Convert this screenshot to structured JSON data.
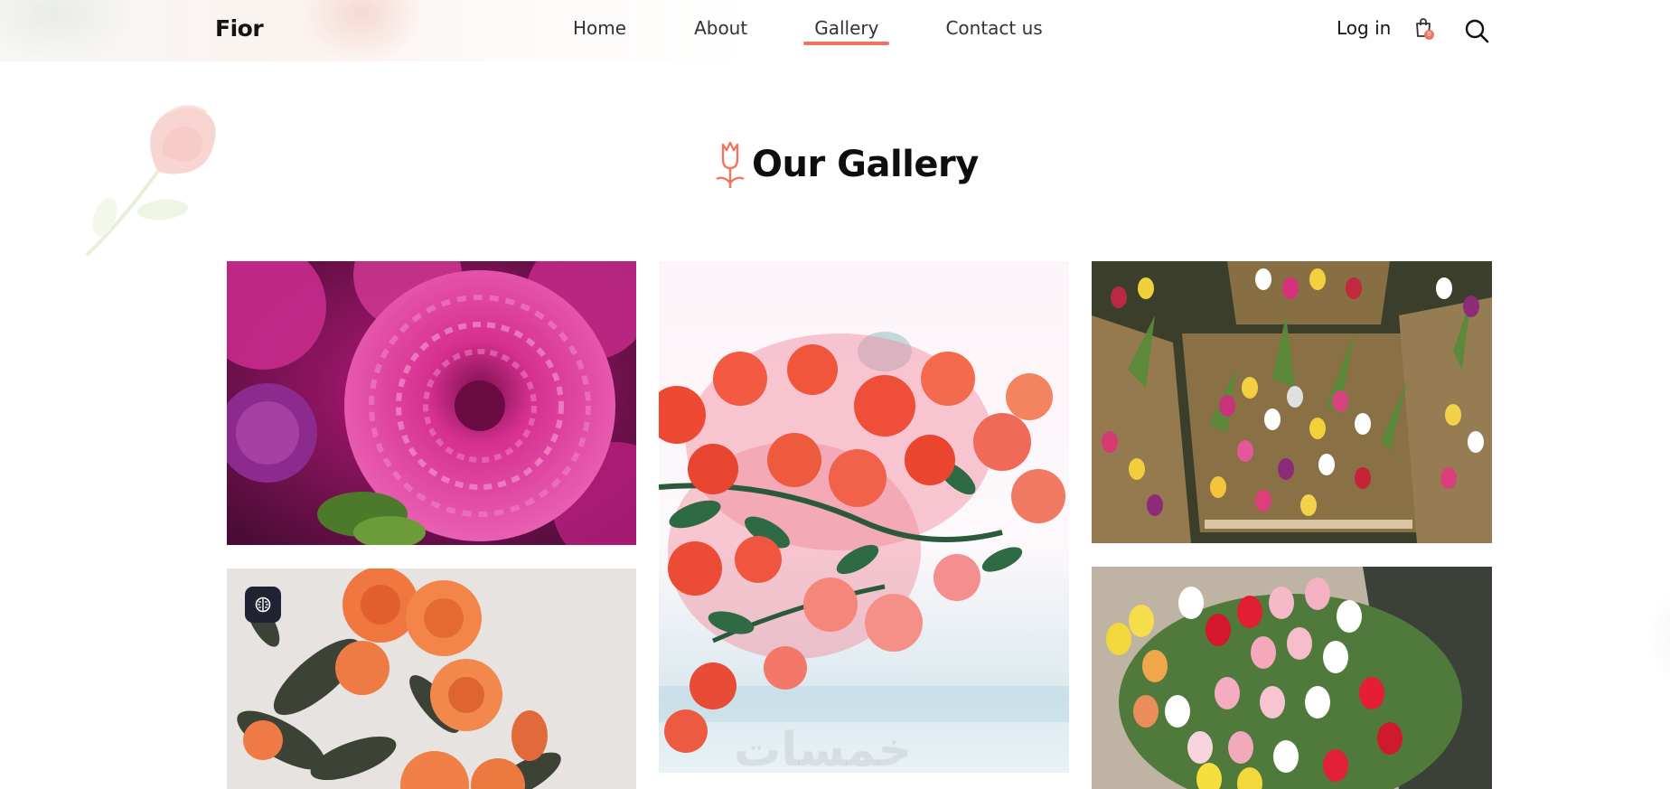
{
  "header": {
    "logo": "Fior",
    "nav": [
      "Home",
      "About",
      "Gallery",
      "Contact us"
    ],
    "active_nav": "Gallery",
    "login_label": "Log in",
    "cart_count": "0",
    "icons": [
      "shopping-bag-icon",
      "search-icon"
    ]
  },
  "gallery": {
    "title": "Our Gallery",
    "title_icon": "tulip-outline-icon",
    "photos": [
      {
        "subject": "pink dahlia"
      },
      {
        "subject": "red bougainvillea"
      },
      {
        "subject": "tulip bouquets in kraft paper"
      },
      {
        "subject": "orange roses"
      },
      {
        "subject": "mixed tulip bouquet"
      }
    ],
    "ai_badge_icon": "brain-icon",
    "watermark": "خمسات"
  },
  "colors": {
    "accent": "#f0745e",
    "text": "#141414",
    "badge_bg": "#1f2333"
  }
}
